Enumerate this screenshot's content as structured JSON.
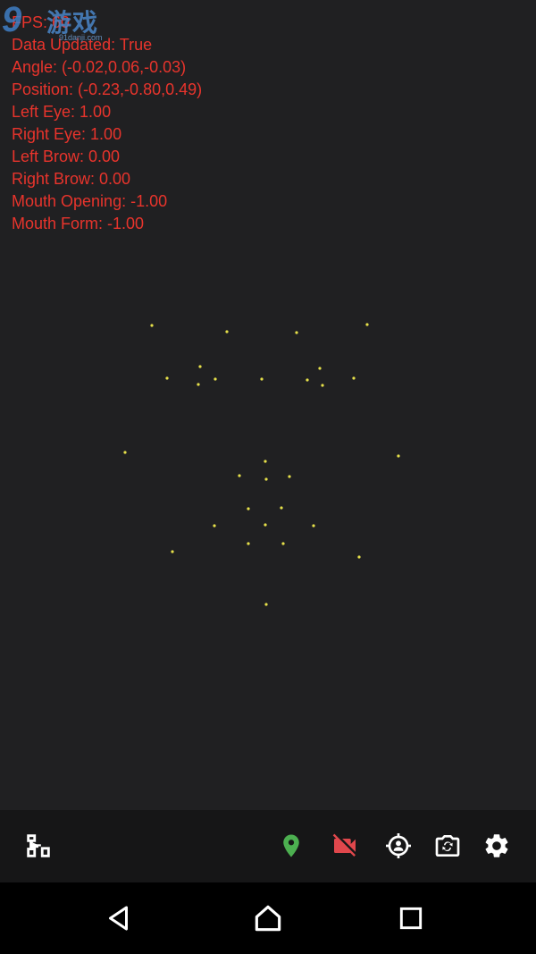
{
  "debug": {
    "lines": [
      "FPS: 60",
      "Data Updated: True",
      "Angle: (-0.02,0.06,-0.03)",
      "Position: (-0.23,-0.80,0.49)",
      "Left Eye: 1.00",
      "Right Eye: 1.00",
      "Left Brow: 0.00",
      "Right Brow: 0.00",
      "Mouth Opening: -1.00",
      "Mouth Form: -1.00"
    ],
    "text_color": "#e8342c"
  },
  "watermark": {
    "logo": "9",
    "name": "游戏",
    "url": "91danji.com"
  },
  "colors": {
    "background": "#202022",
    "landmark": "#e6e04a",
    "toolbar_bg": "#161617",
    "location_icon": "#4caf50",
    "camera_off_icon": "#e0474c",
    "icon_white": "#ffffff"
  },
  "toolbar": {
    "icons": [
      "network-icon",
      "location-pin-icon",
      "camera-off-icon",
      "face-tracking-icon",
      "switch-camera-icon",
      "settings-icon"
    ]
  },
  "navbar": {
    "icons": [
      "back-icon",
      "home-icon",
      "recents-icon"
    ]
  }
}
